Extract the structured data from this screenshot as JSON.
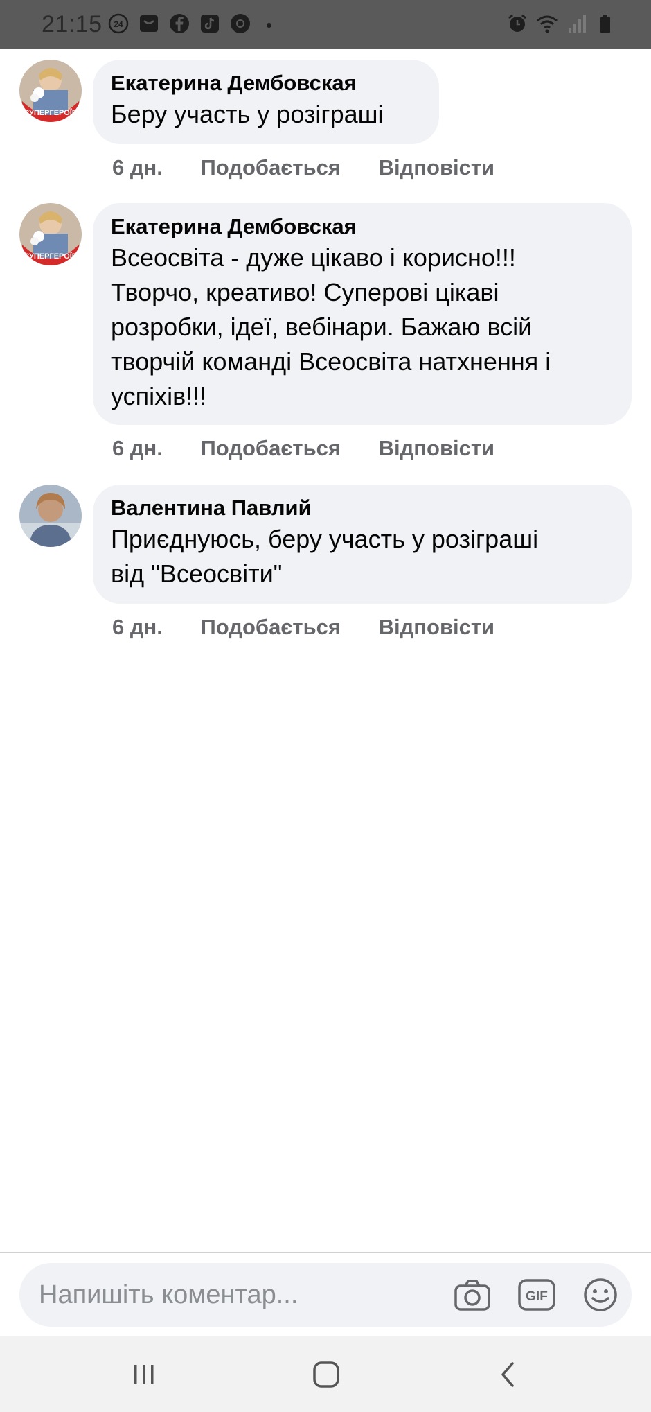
{
  "status_bar": {
    "time": "21:15",
    "icons": [
      "notification-24-icon",
      "inbox-icon",
      "facebook-icon",
      "tiktok-icon",
      "chrome-icon",
      "alarm-icon",
      "wifi-icon",
      "signal-icon",
      "battery-icon"
    ]
  },
  "comments": [
    {
      "author": "Екатерина Дембовская",
      "text": "Беру участь у розіграші",
      "time": "6 дн.",
      "like": "Подобається",
      "reply": "Відповісти"
    },
    {
      "author": "Екатерина Дембовская",
      "text": "Всеосвіта - дуже цікаво і корисно!!!\nТворчо, креативо! Суперові цікаві\nрозробки, ідеї, вебінари. Бажаю всій\nтворчій команді Всеосвіта натхнення і\nуспіхів!!!",
      "time": "6 дн.",
      "like": "Подобається",
      "reply": "Відповісти"
    },
    {
      "author": "Валентина Павлий",
      "text": "Приєднуюсь, беру участь у розіграші\nвід \"Всеосвіти\"",
      "time": "6 дн.",
      "like": "Подобається",
      "reply": "Відповісти"
    }
  ],
  "composer": {
    "placeholder": "Напишіть коментар...",
    "icons": [
      "camera-icon",
      "gif-icon",
      "emoji-icon"
    ]
  },
  "nav": {
    "icons": [
      "recent-apps-icon",
      "home-icon",
      "back-icon"
    ]
  },
  "colors": {
    "bubble": "#f0f2f5",
    "meta_text": "#65676b",
    "status_bar": "#5a5a5a"
  }
}
